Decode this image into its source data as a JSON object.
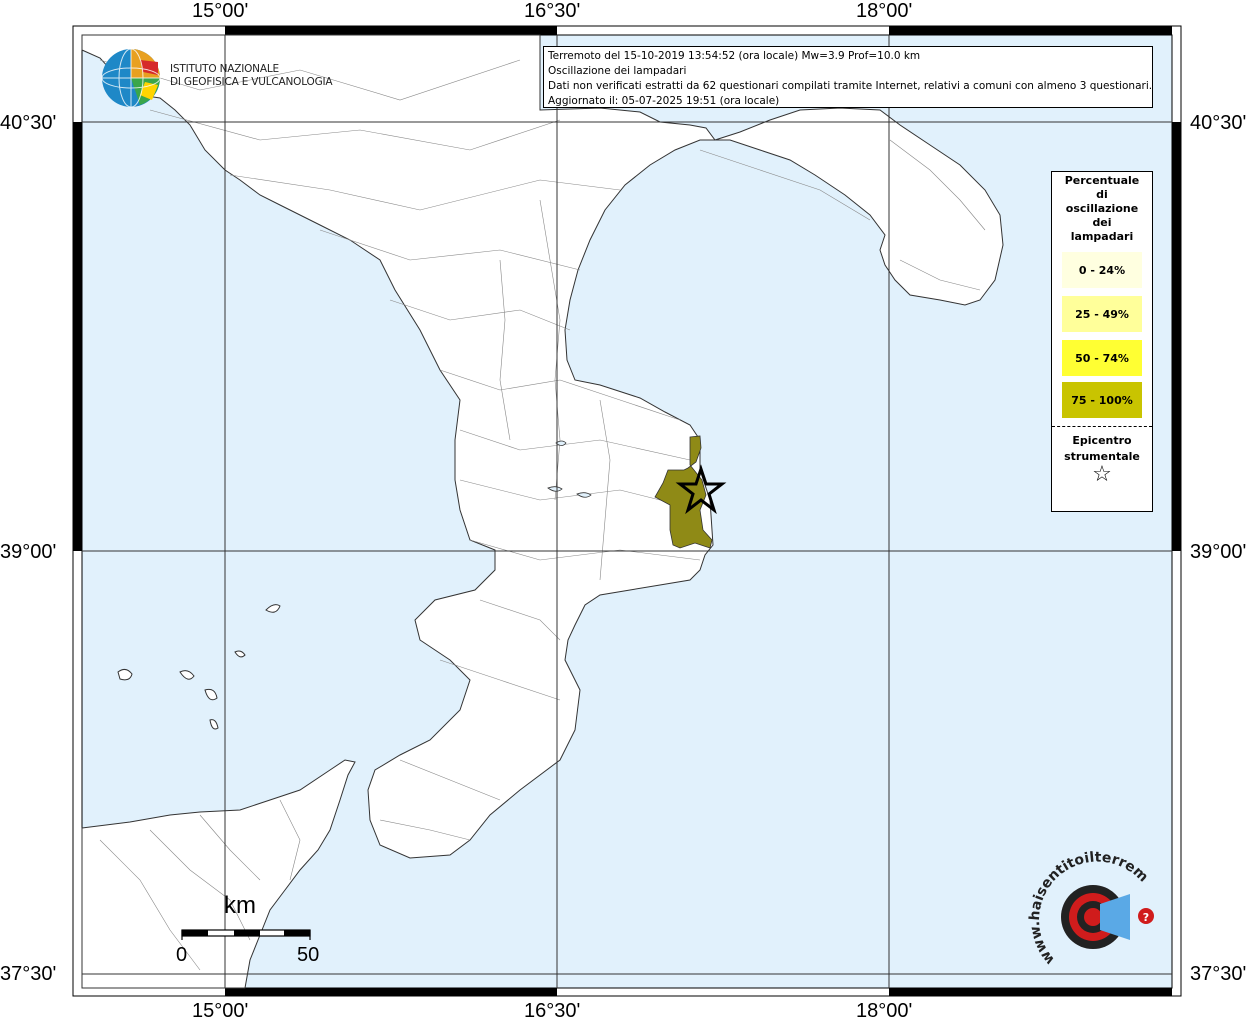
{
  "info": {
    "line1": "Terremoto del 15-10-2019 13:54:52 (ora locale) Mw=3.9 Prof=10.0 km",
    "line2": "Oscillazione dei lampadari",
    "line3": "Dati non verificati estratti da 62 questionari compilati tramite Internet, relativi a comuni con almeno 3 questionari.",
    "line4": "Aggiornato il: 05-07-2025 19:51 (ora locale)"
  },
  "axes": {
    "lon_labels": [
      "15°00'",
      "16°30'",
      "18°00'"
    ],
    "lat_labels": [
      "40°30'",
      "39°00'",
      "37°30'"
    ]
  },
  "legend": {
    "title": "Percentuale di oscillazione dei lampadari",
    "title_lines": [
      "Percentuale",
      "di",
      "oscillazione",
      "dei",
      "lampadari"
    ],
    "classes": [
      {
        "label": "0 - 24%",
        "color": "#ffffe0"
      },
      {
        "label": "25 - 49%",
        "color": "#ffff9a"
      },
      {
        "label": "50 - 74%",
        "color": "#ffff33"
      },
      {
        "label": "75 - 100%",
        "color": "#c9c400"
      }
    ],
    "epicenter_lines": [
      "Epicentro",
      "strumentale"
    ],
    "epicenter_symbol": "☆"
  },
  "logo": {
    "line1": "ISTITUTO NAZIONALE",
    "line2": "DI GEOFISICA E VULCANOLOGIA"
  },
  "scale": {
    "title": "km",
    "min_label": "0",
    "max_label": "50"
  },
  "badge": {
    "text": "www.haisentitoilterremoto.it"
  },
  "colors": {
    "sea": "#e1f1fc",
    "land": "#ffffff",
    "affected": "#8f8a16"
  }
}
